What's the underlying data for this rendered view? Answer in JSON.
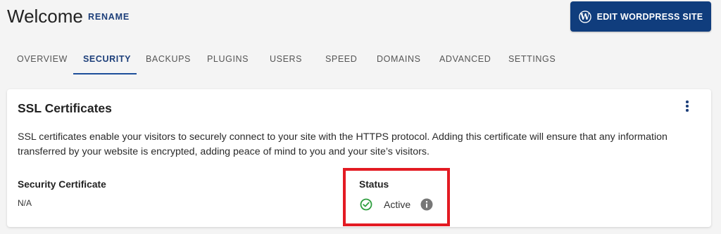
{
  "header": {
    "title": "Welcome",
    "rename_label": "RENAME",
    "edit_button_label": "EDIT WORDPRESS SITE",
    "edit_button_icon": "wordpress-icon"
  },
  "tabs": [
    {
      "label": "OVERVIEW",
      "active": false
    },
    {
      "label": "SECURITY",
      "active": true
    },
    {
      "label": "BACKUPS",
      "active": false
    },
    {
      "label": "PLUGINS",
      "active": false
    },
    {
      "label": "USERS",
      "active": false
    },
    {
      "label": "SPEED",
      "active": false
    },
    {
      "label": "DOMAINS",
      "active": false
    },
    {
      "label": "ADVANCED",
      "active": false
    },
    {
      "label": "SETTINGS",
      "active": false
    }
  ],
  "ssl_card": {
    "title": "SSL Certificates",
    "menu_icon": "more-vertical-icon",
    "description": "SSL certificates enable your visitors to securely connect to your site with the HTTPS protocol. Adding this certificate will ensure that any information transferred by your website is encrypted, adding peace of mind to you and your site’s visitors.",
    "certificate_label": "Security Certificate",
    "certificate_value": "N/A",
    "status_label": "Status",
    "status_value": "Active",
    "status_icon": "check-circle-icon",
    "info_icon": "info-icon"
  },
  "colors": {
    "brand": "#103d7d",
    "active_tab": "#1d3f7a",
    "success": "#2e9e3e",
    "highlight": "#e31b23"
  }
}
